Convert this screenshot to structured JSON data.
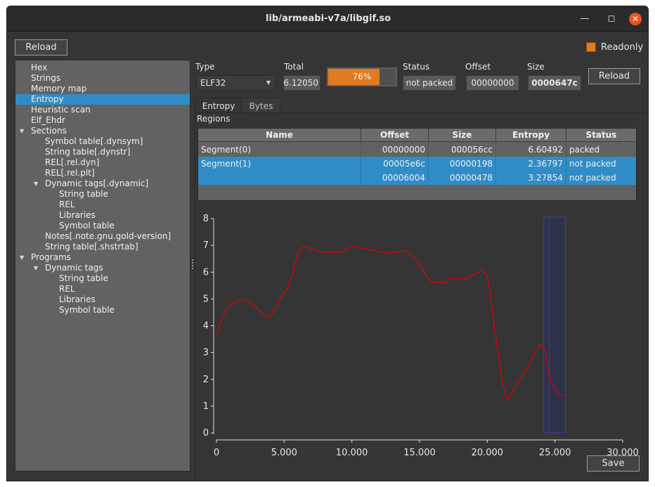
{
  "window": {
    "title": "lib/armeabi-v7a/libgif.so"
  },
  "toolbar": {
    "reload_label": "Reload",
    "readonly_label": "Readonly",
    "readonly_checked": true
  },
  "tree": [
    {
      "label": "Hex",
      "level": 0
    },
    {
      "label": "Strings",
      "level": 0
    },
    {
      "label": "Memory map",
      "level": 0
    },
    {
      "label": "Entropy",
      "level": 0,
      "selected": true
    },
    {
      "label": "Heuristic scan",
      "level": 0
    },
    {
      "label": "Elf_Ehdr",
      "level": 0
    },
    {
      "label": "Sections",
      "level": 0,
      "expanded": true
    },
    {
      "label": "Symbol table[.dynsym]",
      "level": 1
    },
    {
      "label": "String table[.dynstr]",
      "level": 1
    },
    {
      "label": "REL[.rel.dyn]",
      "level": 1
    },
    {
      "label": "REL[.rel.plt]",
      "level": 1
    },
    {
      "label": "Dynamic tags[.dynamic]",
      "level": 1,
      "expanded": true
    },
    {
      "label": "String table",
      "level": 2
    },
    {
      "label": "REL",
      "level": 2
    },
    {
      "label": "Libraries",
      "level": 2
    },
    {
      "label": "Symbol table",
      "level": 2
    },
    {
      "label": "Notes[.note.gnu.gold-version]",
      "level": 1
    },
    {
      "label": "String table[.shstrtab]",
      "level": 1
    },
    {
      "label": "Programs",
      "level": 0,
      "expanded": true
    },
    {
      "label": "Dynamic tags",
      "level": 1,
      "expanded": true
    },
    {
      "label": "String table",
      "level": 2
    },
    {
      "label": "REL",
      "level": 2
    },
    {
      "label": "Libraries",
      "level": 2
    },
    {
      "label": "Symbol table",
      "level": 2
    }
  ],
  "fields": {
    "type_label": "Type",
    "type_value": "ELF32",
    "total_label": "Total",
    "total_value": "6.12050",
    "progress_percent": 76,
    "progress_text": "76%",
    "status_label": "Status",
    "status_value": "not packed",
    "offset_label": "Offset",
    "offset_value": "00000000",
    "size_label": "Size",
    "size_value": "0000647c",
    "reload_label": "Reload"
  },
  "tabs": [
    {
      "label": "Entropy",
      "active": true
    },
    {
      "label": "Bytes",
      "active": false
    }
  ],
  "regions": {
    "label": "Regions",
    "columns": [
      "Name",
      "Offset",
      "Size",
      "Entropy",
      "Status"
    ],
    "rows": [
      {
        "name": "Segment(0)",
        "offset": "00000000",
        "size": "000056cc",
        "entropy": "6.60492",
        "status": "packed",
        "selected": false
      },
      {
        "name": "Segment(1)",
        "offset": "00005e6c",
        "size": "00000198",
        "entropy": "2.36797",
        "status": "not packed",
        "selected": true
      },
      {
        "name": "",
        "offset": "00006004",
        "size": "00000478",
        "entropy": "3.27854",
        "status": "not packed",
        "selected": true
      }
    ]
  },
  "save_label": "Save",
  "chart_data": {
    "type": "line",
    "title": "",
    "xlabel": "",
    "ylabel": "",
    "xlim": [
      0,
      30000
    ],
    "ylim": [
      0,
      8
    ],
    "x_ticks": [
      "0",
      "5.000",
      "10.000",
      "15.000",
      "20.000",
      "25.000",
      "30.000"
    ],
    "y_ticks": [
      "0",
      "1",
      "2",
      "3",
      "4",
      "5",
      "6",
      "7",
      "8"
    ],
    "grid": false,
    "line_color": "#e00000",
    "series": [
      {
        "x": [
          0,
          300,
          700,
          1200,
          1600,
          2000,
          2400,
          2900,
          3300,
          3700,
          4000,
          4400,
          4800,
          5200,
          5600,
          6000,
          6400,
          6800,
          7400,
          8000,
          8600,
          9200,
          9700,
          10200,
          10700,
          11200,
          11700,
          12200,
          12800,
          13400,
          13900,
          14300,
          14800,
          15200,
          15600,
          16000,
          16400,
          16800,
          17200,
          17600,
          18000,
          18400,
          18800,
          19200,
          19600,
          20000,
          20300,
          20700,
          21100,
          21500,
          22000,
          22400,
          22800,
          23200,
          23600,
          24000,
          24300,
          24600,
          24900,
          25200,
          25500,
          25800
        ],
        "y": [
          3.6,
          4.1,
          4.6,
          4.85,
          4.9,
          5.0,
          4.85,
          4.7,
          4.5,
          4.3,
          4.35,
          4.7,
          5.1,
          5.35,
          5.9,
          6.7,
          6.95,
          6.9,
          6.8,
          6.75,
          6.75,
          6.75,
          6.9,
          6.95,
          6.9,
          6.85,
          6.8,
          6.75,
          6.7,
          6.75,
          6.8,
          6.65,
          6.45,
          6.1,
          5.8,
          5.6,
          5.65,
          5.6,
          5.75,
          5.75,
          5.75,
          5.75,
          5.85,
          5.95,
          6.05,
          5.9,
          4.9,
          3.3,
          1.9,
          1.2,
          1.65,
          2.0,
          2.3,
          2.6,
          3.1,
          3.3,
          3.0,
          2.0,
          1.8,
          1.45,
          1.4,
          1.4
        ]
      }
    ],
    "highlight": {
      "x_start": 24172,
      "x_end": 25772,
      "line": 24580
    }
  }
}
